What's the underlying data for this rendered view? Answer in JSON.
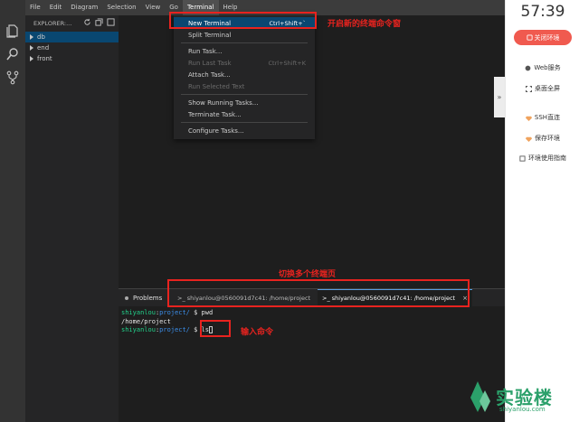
{
  "menubar": {
    "items": [
      "File",
      "Edit",
      "Diagram",
      "Selection",
      "View",
      "Go",
      "Terminal",
      "Help"
    ],
    "active": "Terminal"
  },
  "explorer": {
    "title": "EXPLORER:...",
    "folders": [
      "db",
      "end",
      "front"
    ]
  },
  "terminal_menu": {
    "new_terminal": {
      "label": "New Terminal",
      "shortcut": "Ctrl+Shift+`"
    },
    "split_terminal": "Split Terminal",
    "run_task": "Run Task...",
    "run_last_task": {
      "label": "Run Last Task",
      "shortcut": "Ctrl+Shift+K"
    },
    "attach_task": "Attach Task...",
    "run_selected_text": "Run Selected Text",
    "show_running_tasks": "Show Running Tasks...",
    "terminate_task": "Terminate Task...",
    "configure_tasks": "Configure Tasks..."
  },
  "panel": {
    "problems_label": "Problems",
    "terminal_tab_1": ">_ shiyanlou@0560091d7c41: /home/project",
    "terminal_tab_2": ">_ shiyanlou@0560091d7c41: /home/project",
    "close_symbol": "×"
  },
  "terminal": {
    "user": "shiyanlou",
    "path": "project/",
    "prompt_sep": ":",
    "prompt_end": " $ ",
    "cmd1": "pwd",
    "output1": "/home/project",
    "cmd2": "ls"
  },
  "annotations": {
    "new_terminal_note": "开启新的终端命令窗",
    "switch_tabs_note": "切换多个终端页",
    "input_note": "输入命令"
  },
  "right_panel": {
    "timer": "57:39",
    "close_env": "关闭环境",
    "web_service": "Web服务",
    "desktop_fullscreen": "桌面全屏",
    "ssh": "SSH直连",
    "save_env": "保存环境",
    "guide": "环境使用指南",
    "collapse_symbol": "»"
  },
  "logo": {
    "name": "实验楼",
    "domain": "shiyanlou.com"
  },
  "colors": {
    "annotation_red": "#e8231f",
    "accent_blue": "#094771",
    "prompt_green": "#23d18b",
    "prompt_blue": "#3b8eea",
    "close_button": "#f05a4f",
    "logo_green": "#2ba06a"
  }
}
